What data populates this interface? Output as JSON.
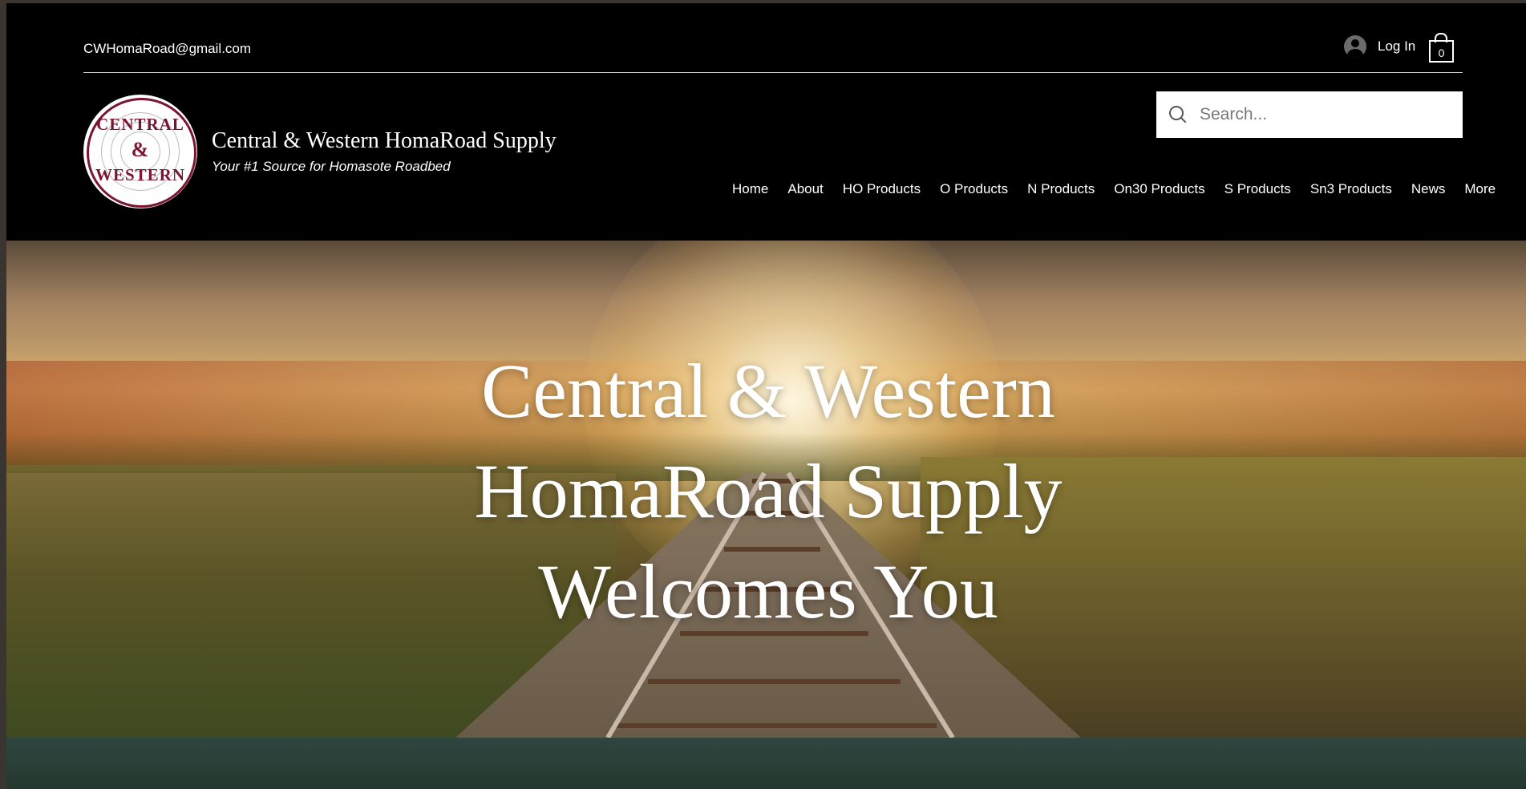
{
  "header": {
    "email": "CWHomaRoad@gmail.com",
    "login_label": "Log In",
    "cart_count": "0",
    "brand_title": "Central & Western HomaRoad Supply",
    "tagline": "Your #1 Source for Homasote Roadbed",
    "logo_text": [
      "CENTRAL",
      "&",
      "WESTERN"
    ]
  },
  "search": {
    "placeholder": "Search..."
  },
  "nav": {
    "items": [
      "Home",
      "About",
      "HO Products",
      "O Products",
      "N Products",
      "On30 Products",
      "S Products",
      "Sn3 Products",
      "News",
      "More"
    ]
  },
  "hero": {
    "title_lines": [
      "Central & Western",
      "HomaRoad Supply",
      "Welcomes You"
    ]
  },
  "colors": {
    "header_bg": "#000000",
    "logo_red": "#7a1530",
    "band": "#2f4640"
  },
  "icons": [
    "avatar-icon",
    "cart-icon",
    "search-icon"
  ]
}
